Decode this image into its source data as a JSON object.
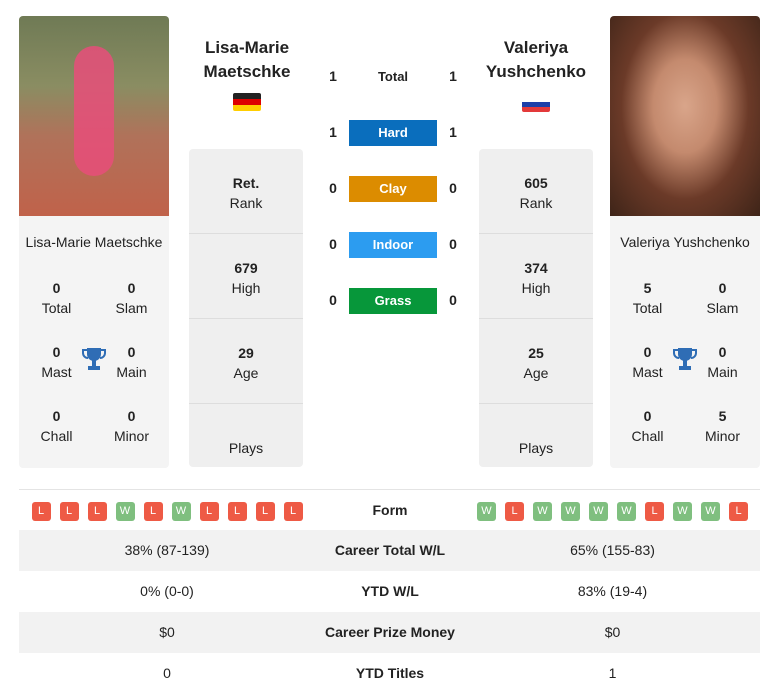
{
  "player1": {
    "name": "Lisa-Marie Maetschke",
    "name_line1": "Lisa-Marie",
    "name_line2": "Maetschke",
    "flag": "germany",
    "titles": {
      "total": "0",
      "slam": "0",
      "mast": "0",
      "main": "0",
      "chall": "0",
      "minor": "0"
    },
    "rank": "Ret.",
    "high": "679",
    "age": "29",
    "plays": "Plays"
  },
  "player2": {
    "name": "Valeriya Yushchenko",
    "name_line1": "Valeriya",
    "name_line2": "Yushchenko",
    "flag": "russia",
    "titles": {
      "total": "5",
      "slam": "0",
      "mast": "0",
      "main": "0",
      "chall": "0",
      "minor": "5"
    },
    "rank": "605",
    "high": "374",
    "age": "25",
    "plays": "Plays"
  },
  "labels": {
    "total": "Total",
    "slam": "Slam",
    "mast": "Mast",
    "main": "Main",
    "chall": "Chall",
    "minor": "Minor",
    "rank": "Rank",
    "high": "High",
    "age": "Age"
  },
  "h2h": [
    {
      "label": "Total",
      "p1": "1",
      "p2": "1"
    },
    {
      "label": "Hard",
      "p1": "1",
      "p2": "1",
      "color": "#0a6ebd"
    },
    {
      "label": "Clay",
      "p1": "0",
      "p2": "0",
      "color": "#dc8c00"
    },
    {
      "label": "Indoor",
      "p1": "0",
      "p2": "0",
      "color": "#2c9cf0"
    },
    {
      "label": "Grass",
      "p1": "0",
      "p2": "0",
      "color": "#07973a"
    }
  ],
  "form": {
    "label": "Form",
    "p1": [
      "L",
      "L",
      "L",
      "W",
      "L",
      "W",
      "L",
      "L",
      "L",
      "L"
    ],
    "p2": [
      "W",
      "L",
      "W",
      "W",
      "W",
      "W",
      "L",
      "W",
      "W",
      "L"
    ],
    "win_color": "#7fbf7f",
    "loss_color": "#ee5a45"
  },
  "table": [
    {
      "label": "Career Total W/L",
      "p1": "38% (87-139)",
      "p2": "65% (155-83)"
    },
    {
      "label": "YTD W/L",
      "p1": "0% (0-0)",
      "p2": "83% (19-4)"
    },
    {
      "label": "Career Prize Money",
      "p1": "$0",
      "p2": "$0"
    },
    {
      "label": "YTD Titles",
      "p1": "0",
      "p2": "1"
    }
  ]
}
